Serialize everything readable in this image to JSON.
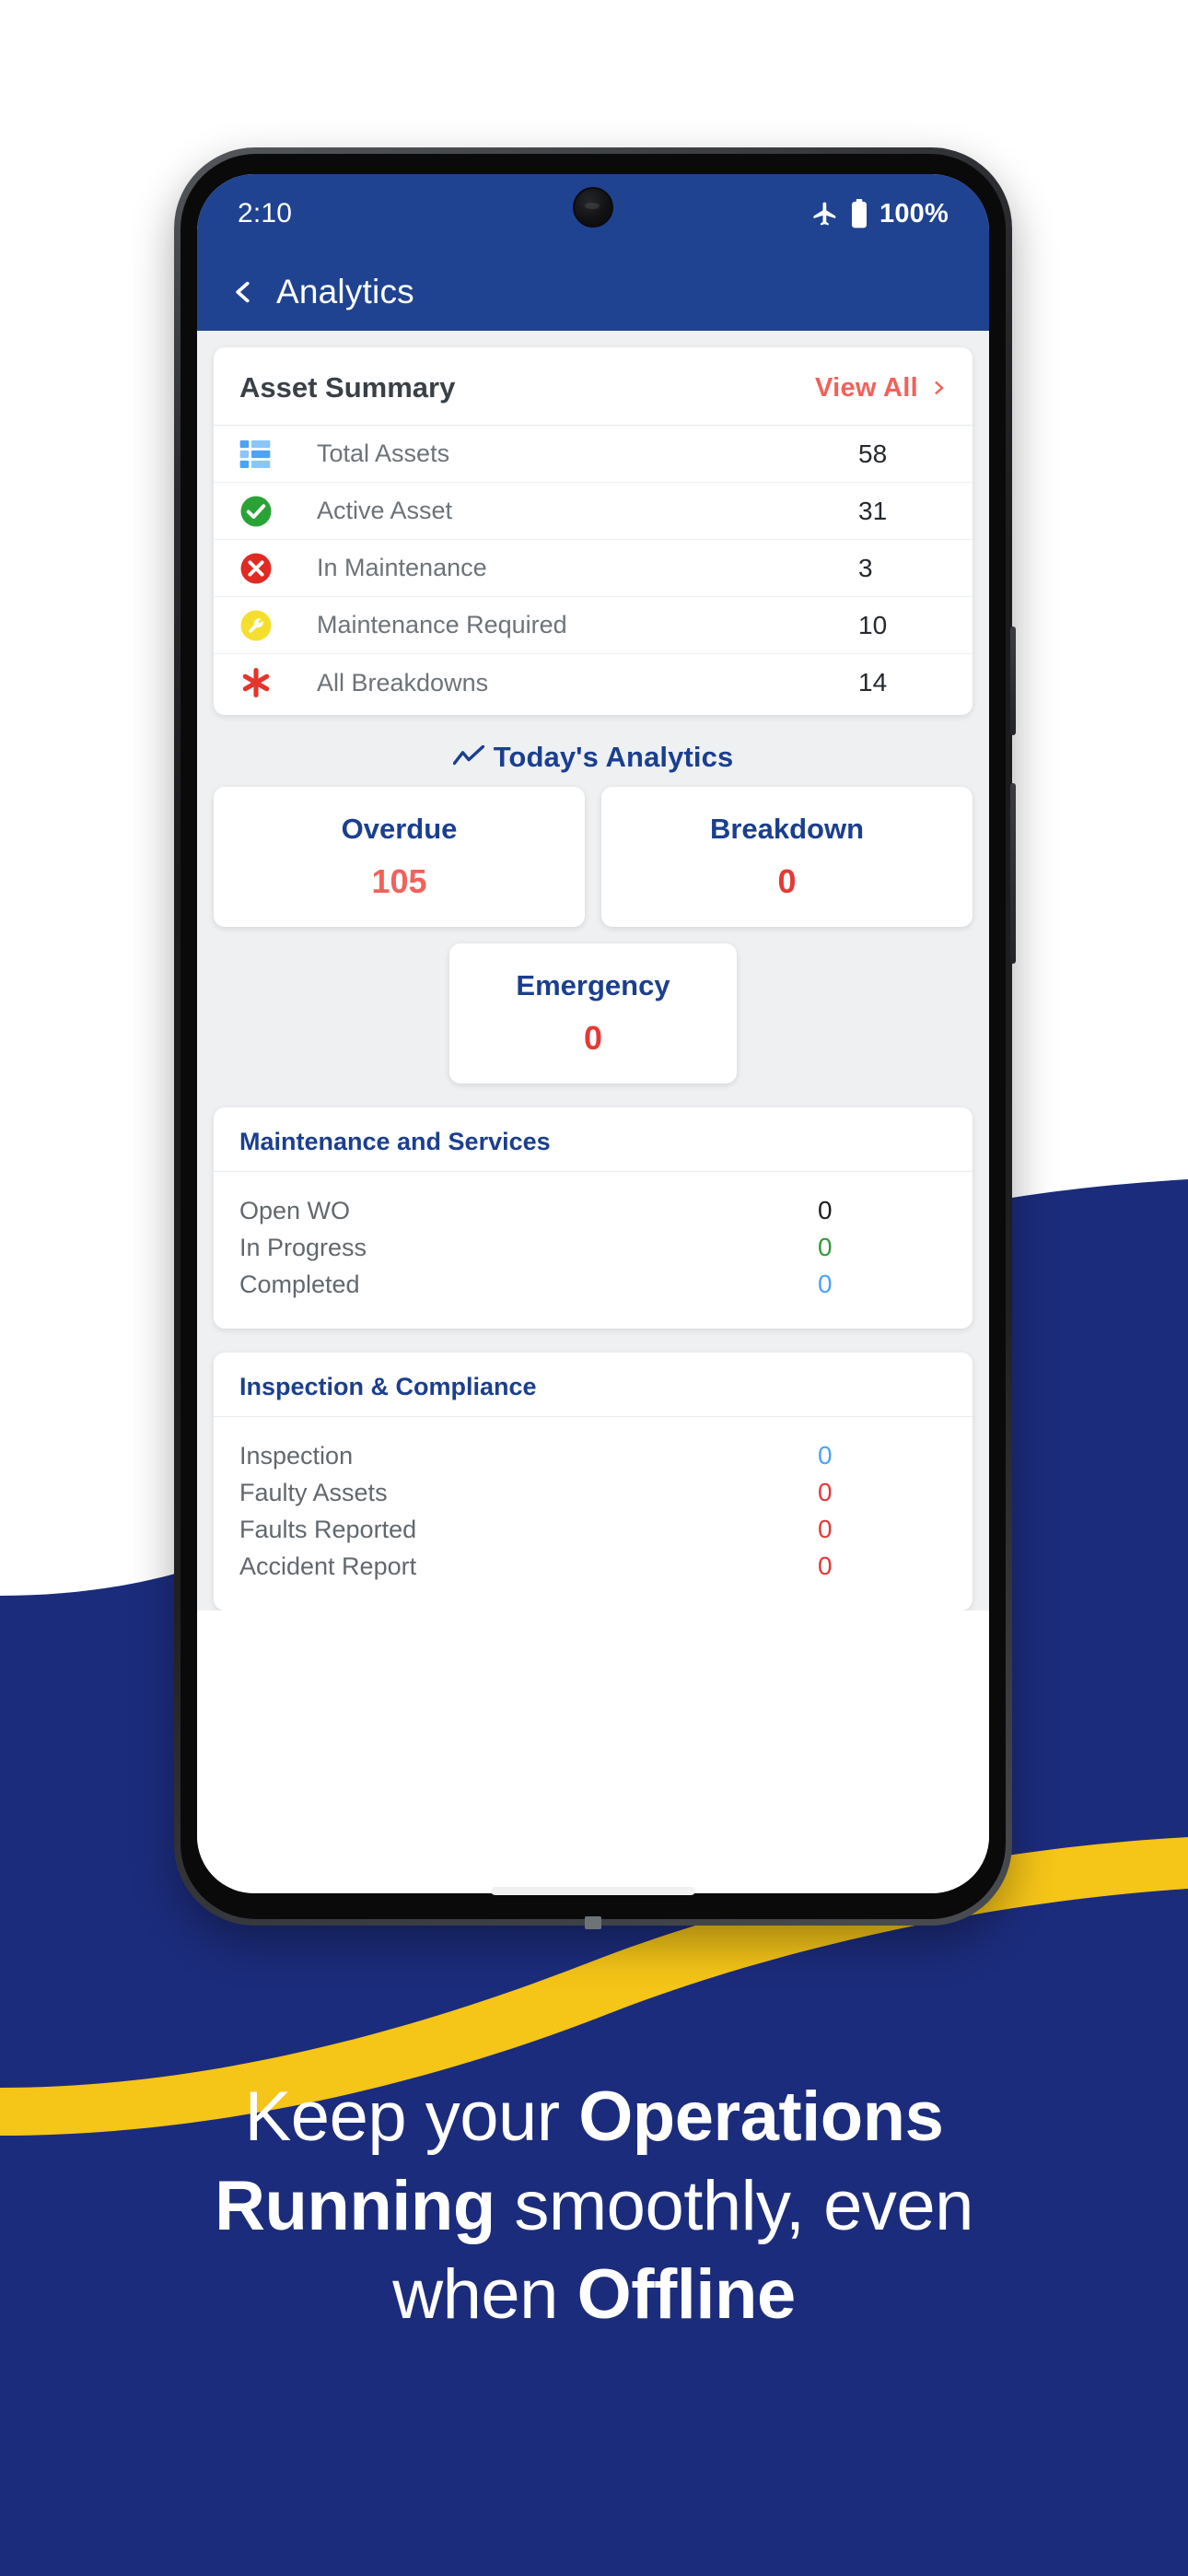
{
  "theme": {
    "brand_navy": "#1b3f8f",
    "appbar_blue": "#1f4391",
    "background_navy": "#1c2c7c",
    "accent_yellow": "#f5c518",
    "accent_salmon": "#f2615b",
    "red": "#e53935",
    "green": "#2e9c37",
    "light_blue": "#4da3f5"
  },
  "status_bar": {
    "time": "2:10",
    "airplane_icon": "airplane-mode-icon",
    "battery_icon": "battery-full-icon",
    "battery_text": "100%"
  },
  "app_bar": {
    "back_icon": "back-chevron-icon",
    "title": "Analytics"
  },
  "asset_summary": {
    "title": "Asset Summary",
    "view_all_label": "View All",
    "view_all_chevron": "chevron-right-icon",
    "rows": [
      {
        "icon": "list-grid-icon",
        "label": "Total Assets",
        "value": "58"
      },
      {
        "icon": "check-circle-icon",
        "label": "Active Asset",
        "value": "31"
      },
      {
        "icon": "x-circle-icon",
        "label": "In Maintenance",
        "value": "3"
      },
      {
        "icon": "wrench-circle-icon",
        "label": "Maintenance Required",
        "value": "10"
      },
      {
        "icon": "asterisk-burst-icon",
        "label": "All Breakdowns",
        "value": "14"
      }
    ]
  },
  "todays_analytics": {
    "icon": "trend-line-icon",
    "title": "Today's Analytics",
    "tiles": [
      {
        "label": "Overdue",
        "value": "105",
        "color": "#f2615b"
      },
      {
        "label": "Breakdown",
        "value": "0",
        "color": "#e53935"
      },
      {
        "label": "Emergency",
        "value": "0",
        "color": "#e53935"
      }
    ]
  },
  "maintenance_services": {
    "title": "Maintenance and Services",
    "rows": [
      {
        "label": "Open WO",
        "value": "0",
        "color": "#1d1d1d"
      },
      {
        "label": "In Progress",
        "value": "0",
        "color": "#2e9c37"
      },
      {
        "label": "Completed",
        "value": "0",
        "color": "#4da3f5"
      }
    ]
  },
  "inspection_compliance": {
    "title": "Inspection & Compliance",
    "rows": [
      {
        "label": "Inspection",
        "value": "0",
        "color": "#4da3f5"
      },
      {
        "label": "Faulty Assets",
        "value": "0",
        "color": "#e53935"
      },
      {
        "label": "Faults Reported",
        "value": "0",
        "color": "#e53935"
      },
      {
        "label": "Accident Report",
        "value": "0",
        "color": "#e53935"
      }
    ]
  },
  "headline": {
    "line1_plain_a": "Keep your ",
    "line1_bold": "Operations",
    "line2_bold": "Running",
    "line2_plain": " smoothly, even",
    "line3_plain": "when ",
    "line3_bold": "Offline"
  }
}
